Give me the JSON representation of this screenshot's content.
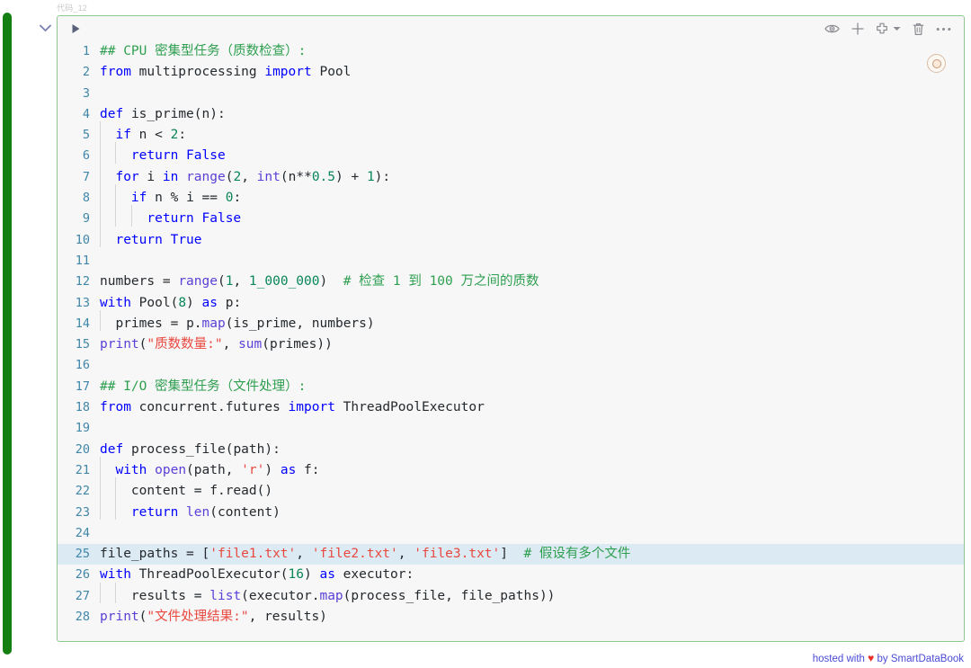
{
  "cell": {
    "label": "代码_12",
    "collapse_icon": "chevron-down-icon",
    "run_icon": "play-triangle-icon",
    "border_color": "#8ec98e",
    "background_color": "#f7f7f7",
    "highlight_color": "#dceaf4"
  },
  "exec_bar": {
    "name": "execution-status-bar",
    "color": "#148014"
  },
  "toolbar": {
    "items": [
      {
        "name": "eye-icon",
        "label": "查看"
      },
      {
        "name": "plus-icon",
        "label": "添加"
      },
      {
        "name": "duplicate-icon",
        "label": "复制"
      },
      {
        "name": "chevron-down-icon",
        "label": "更多复制选项"
      },
      {
        "name": "trash-icon",
        "label": "删除"
      },
      {
        "name": "ellipsis-icon",
        "label": "更多"
      }
    ]
  },
  "kernel_badge": {
    "name": "kernel-status-badge",
    "border_color": "#d9bda6",
    "inner_color": "#c79a78"
  },
  "editor": {
    "language": "python",
    "highlighted_line": 25,
    "total_lines": 28,
    "line_number_color": "#3f86a8",
    "token_colors": {
      "keyword": "#0000ff",
      "function": "#5b3fd6",
      "number": "#098658",
      "string": "#e8483f",
      "comment": "#2e9e4f",
      "plain": "#24292e"
    },
    "lines": [
      {
        "n": 1,
        "text": "## CPU 密集型任务（质数检查）:"
      },
      {
        "n": 2,
        "text": "from multiprocessing import Pool"
      },
      {
        "n": 3,
        "text": ""
      },
      {
        "n": 4,
        "text": "def is_prime(n):"
      },
      {
        "n": 5,
        "text": "  if n < 2:"
      },
      {
        "n": 6,
        "text": "    return False"
      },
      {
        "n": 7,
        "text": "  for i in range(2, int(n**0.5) + 1):"
      },
      {
        "n": 8,
        "text": "    if n % i == 0:"
      },
      {
        "n": 9,
        "text": "      return False"
      },
      {
        "n": 10,
        "text": "  return True"
      },
      {
        "n": 11,
        "text": ""
      },
      {
        "n": 12,
        "text": "numbers = range(1, 1_000_000)  # 检查 1 到 100 万之间的质数"
      },
      {
        "n": 13,
        "text": "with Pool(8) as p:"
      },
      {
        "n": 14,
        "text": "  primes = p.map(is_prime, numbers)"
      },
      {
        "n": 15,
        "text": "print(\"质数数量:\", sum(primes))"
      },
      {
        "n": 16,
        "text": ""
      },
      {
        "n": 17,
        "text": "## I/O 密集型任务（文件处理）:"
      },
      {
        "n": 18,
        "text": "from concurrent.futures import ThreadPoolExecutor"
      },
      {
        "n": 19,
        "text": ""
      },
      {
        "n": 20,
        "text": "def process_file(path):"
      },
      {
        "n": 21,
        "text": "  with open(path, 'r') as f:"
      },
      {
        "n": 22,
        "text": "    content = f.read()"
      },
      {
        "n": 23,
        "text": "    return len(content)"
      },
      {
        "n": 24,
        "text": ""
      },
      {
        "n": 25,
        "text": "file_paths = ['file1.txt', 'file2.txt', 'file3.txt']  # 假设有多个文件"
      },
      {
        "n": 26,
        "text": "with ThreadPoolExecutor(16) as executor:"
      },
      {
        "n": 27,
        "text": "    results = list(executor.map(process_file, file_paths))"
      },
      {
        "n": 28,
        "text": "print(\"文件处理结果:\", results)"
      }
    ]
  },
  "footer": {
    "prefix": "hosted with",
    "heart": "♥",
    "suffix": "by SmartDataBook"
  }
}
